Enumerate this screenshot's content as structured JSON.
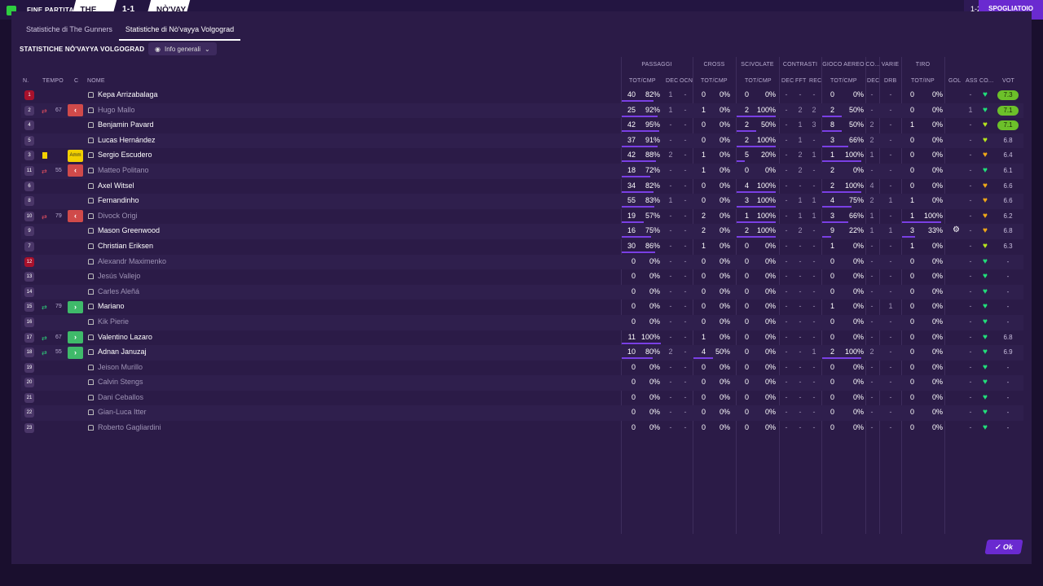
{
  "topbar": {
    "match_status": "FINE PARTITA",
    "home_abbr": "THE GU",
    "score": "1-1",
    "away_abbr": "NÒ'VAY",
    "score_right": "1-2",
    "dressing_room": "SPOGLIATOIO"
  },
  "tabs": [
    "Statistiche di The Gunners",
    "Statistiche di Nò'vayya Volgograd"
  ],
  "section_title": "STATISTICHE NÒ'VAYYA VOLGOGRAD",
  "filter_label": "Info generali",
  "groups": {
    "passaggi": "PASSAGGI",
    "cross": "CROSS",
    "scivolate": "SCIVOLATE",
    "contrasti": "CONTRASTI",
    "gioco_aereo": "GIOCO AEREO",
    "co": "CO...",
    "varie": "VARIE",
    "tiro": "TIRO"
  },
  "columns": {
    "n": "N.",
    "tempo": "TEMPO",
    "c": "C",
    "nome": "NOME",
    "pass_totcmp": "TOT/CMP",
    "pass_dec": "DEC",
    "pass_ocn": "OCN",
    "cross_totcmp": "TOT/CMP",
    "sciv_totcmp": "TOT/CMP",
    "con_dec": "DEC",
    "con_fft": "FFT",
    "con_rec": "REC",
    "aereo_totcmp": "TOT/CMP",
    "co_dec": "DEC",
    "varie_drb": "DRB",
    "tiro_totinp": "TOT/INP",
    "gol": "GOL",
    "ass": "ASS",
    "co2": "CO...",
    "voto": "VOT"
  },
  "players": [
    {
      "n": "1",
      "red": true,
      "sub": "",
      "mins": "",
      "c": "",
      "name": "Kepa Arrizabalaga",
      "dim": false,
      "p1": "40",
      "p2": "82%",
      "pb": 82,
      "pdec": "1",
      "pocn": "-",
      "c1": "0",
      "c2": "0%",
      "cb": 0,
      "s1": "0",
      "s2": "0%",
      "sb": 0,
      "cdec": "-",
      "cfft": "-",
      "crec": "-",
      "a1": "0",
      "a2": "0%",
      "ab": 0,
      "codec": "-",
      "drb": "-",
      "t1": "0",
      "t2": "0%",
      "tb": 0,
      "gol": "",
      "ass": "-",
      "heart": "green",
      "vote": "7.3",
      "hi": true
    },
    {
      "n": "2",
      "red": false,
      "sub": "out",
      "mins": "67",
      "c": "out",
      "name": "Hugo Mallo",
      "dim": true,
      "p1": "25",
      "p2": "92%",
      "pb": 92,
      "pdec": "1",
      "pocn": "-",
      "c1": "1",
      "c2": "0%",
      "cb": 0,
      "s1": "2",
      "s2": "100%",
      "sb": 100,
      "cdec": "-",
      "cfft": "2",
      "crec": "2",
      "a1": "2",
      "a2": "50%",
      "ab": 50,
      "codec": "-",
      "drb": "-",
      "t1": "0",
      "t2": "0%",
      "tb": 0,
      "gol": "",
      "ass": "1",
      "heart": "green",
      "vote": "7.1",
      "hi": true
    },
    {
      "n": "4",
      "red": false,
      "sub": "",
      "mins": "",
      "c": "",
      "name": "Benjamin Pavard",
      "dim": false,
      "p1": "42",
      "p2": "95%",
      "pb": 95,
      "pdec": "-",
      "pocn": "-",
      "c1": "0",
      "c2": "0%",
      "cb": 0,
      "s1": "2",
      "s2": "50%",
      "sb": 50,
      "cdec": "-",
      "cfft": "1",
      "crec": "3",
      "a1": "8",
      "a2": "50%",
      "ab": 50,
      "codec": "2",
      "drb": "-",
      "t1": "1",
      "t2": "0%",
      "tb": 0,
      "gol": "",
      "ass": "-",
      "heart": "lime",
      "vote": "7.1",
      "hi": true
    },
    {
      "n": "5",
      "red": false,
      "sub": "",
      "mins": "",
      "c": "",
      "name": "Lucas Hernández",
      "dim": false,
      "p1": "37",
      "p2": "91%",
      "pb": 91,
      "pdec": "-",
      "pocn": "-",
      "c1": "0",
      "c2": "0%",
      "cb": 0,
      "s1": "2",
      "s2": "100%",
      "sb": 100,
      "cdec": "-",
      "cfft": "1",
      "crec": "-",
      "a1": "3",
      "a2": "66%",
      "ab": 66,
      "codec": "2",
      "drb": "-",
      "t1": "0",
      "t2": "0%",
      "tb": 0,
      "gol": "",
      "ass": "-",
      "heart": "lime",
      "vote": "6.8",
      "hi": false
    },
    {
      "n": "3",
      "red": false,
      "sub": "yellow",
      "mins": "",
      "c": "amm",
      "name": "Sergio Escudero",
      "dim": false,
      "p1": "42",
      "p2": "88%",
      "pb": 88,
      "pdec": "2",
      "pocn": "-",
      "c1": "1",
      "c2": "0%",
      "cb": 0,
      "s1": "5",
      "s2": "20%",
      "sb": 20,
      "cdec": "-",
      "cfft": "2",
      "crec": "1",
      "a1": "1",
      "a2": "100%",
      "ab": 100,
      "codec": "1",
      "drb": "-",
      "t1": "0",
      "t2": "0%",
      "tb": 0,
      "gol": "",
      "ass": "-",
      "heart": "orange",
      "vote": "6.4",
      "hi": false
    },
    {
      "n": "11",
      "red": false,
      "sub": "out",
      "mins": "55",
      "c": "out",
      "name": "Matteo Politano",
      "dim": true,
      "p1": "18",
      "p2": "72%",
      "pb": 72,
      "pdec": "-",
      "pocn": "-",
      "c1": "1",
      "c2": "0%",
      "cb": 0,
      "s1": "0",
      "s2": "0%",
      "sb": 0,
      "cdec": "-",
      "cfft": "2",
      "crec": "-",
      "a1": "2",
      "a2": "0%",
      "ab": 0,
      "codec": "-",
      "drb": "-",
      "t1": "0",
      "t2": "0%",
      "tb": 0,
      "gol": "",
      "ass": "-",
      "heart": "green",
      "vote": "6.1",
      "hi": false
    },
    {
      "n": "6",
      "red": false,
      "sub": "",
      "mins": "",
      "c": "",
      "name": "Axel Witsel",
      "dim": false,
      "p1": "34",
      "p2": "82%",
      "pb": 82,
      "pdec": "-",
      "pocn": "-",
      "c1": "0",
      "c2": "0%",
      "cb": 0,
      "s1": "4",
      "s2": "100%",
      "sb": 100,
      "cdec": "-",
      "cfft": "-",
      "crec": "-",
      "a1": "2",
      "a2": "100%",
      "ab": 100,
      "codec": "4",
      "drb": "-",
      "t1": "0",
      "t2": "0%",
      "tb": 0,
      "gol": "",
      "ass": "-",
      "heart": "orange",
      "vote": "6.6",
      "hi": false
    },
    {
      "n": "8",
      "red": false,
      "sub": "",
      "mins": "",
      "c": "",
      "name": "Fernandinho",
      "dim": false,
      "p1": "55",
      "p2": "83%",
      "pb": 83,
      "pdec": "1",
      "pocn": "-",
      "c1": "0",
      "c2": "0%",
      "cb": 0,
      "s1": "3",
      "s2": "100%",
      "sb": 100,
      "cdec": "-",
      "cfft": "1",
      "crec": "1",
      "a1": "4",
      "a2": "75%",
      "ab": 75,
      "codec": "2",
      "drb": "1",
      "t1": "1",
      "t2": "0%",
      "tb": 0,
      "gol": "",
      "ass": "-",
      "heart": "orange",
      "vote": "6.6",
      "hi": false
    },
    {
      "n": "10",
      "red": false,
      "sub": "out",
      "mins": "79",
      "c": "out",
      "name": "Divock Origi",
      "dim": true,
      "p1": "19",
      "p2": "57%",
      "pb": 57,
      "pdec": "-",
      "pocn": "-",
      "c1": "2",
      "c2": "0%",
      "cb": 0,
      "s1": "1",
      "s2": "100%",
      "sb": 100,
      "cdec": "-",
      "cfft": "1",
      "crec": "1",
      "a1": "3",
      "a2": "66%",
      "ab": 66,
      "codec": "1",
      "drb": "-",
      "t1": "1",
      "t2": "100%",
      "tb": 100,
      "gol": "",
      "ass": "-",
      "heart": "orange",
      "vote": "6.2",
      "hi": false
    },
    {
      "n": "9",
      "red": false,
      "sub": "",
      "mins": "",
      "c": "",
      "name": "Mason Greenwood",
      "dim": false,
      "p1": "16",
      "p2": "75%",
      "pb": 75,
      "pdec": "-",
      "pocn": "-",
      "c1": "2",
      "c2": "0%",
      "cb": 0,
      "s1": "2",
      "s2": "100%",
      "sb": 100,
      "cdec": "-",
      "cfft": "2",
      "crec": "-",
      "a1": "9",
      "a2": "22%",
      "ab": 22,
      "codec": "1",
      "drb": "1",
      "t1": "3",
      "t2": "33%",
      "tb": 33,
      "gol": "gear",
      "ass": "-",
      "heart": "orange",
      "vote": "6.8",
      "hi": false
    },
    {
      "n": "7",
      "red": false,
      "sub": "",
      "mins": "",
      "c": "",
      "name": "Christian Eriksen",
      "dim": false,
      "p1": "30",
      "p2": "86%",
      "pb": 86,
      "pdec": "-",
      "pocn": "-",
      "c1": "1",
      "c2": "0%",
      "cb": 0,
      "s1": "0",
      "s2": "0%",
      "sb": 0,
      "cdec": "-",
      "cfft": "-",
      "crec": "-",
      "a1": "1",
      "a2": "0%",
      "ab": 0,
      "codec": "-",
      "drb": "-",
      "t1": "1",
      "t2": "0%",
      "tb": 0,
      "gol": "",
      "ass": "-",
      "heart": "lime",
      "vote": "6.3",
      "hi": false
    },
    {
      "n": "12",
      "red": true,
      "sub": "",
      "mins": "",
      "c": "",
      "name": "Alexandr Maximenko",
      "dim": true,
      "p1": "0",
      "p2": "0%",
      "pb": 0,
      "pdec": "-",
      "pocn": "-",
      "c1": "0",
      "c2": "0%",
      "cb": 0,
      "s1": "0",
      "s2": "0%",
      "sb": 0,
      "cdec": "-",
      "cfft": "-",
      "crec": "-",
      "a1": "0",
      "a2": "0%",
      "ab": 0,
      "codec": "-",
      "drb": "-",
      "t1": "0",
      "t2": "0%",
      "tb": 0,
      "gol": "",
      "ass": "-",
      "heart": "green",
      "vote": "-",
      "hi": false
    },
    {
      "n": "13",
      "red": false,
      "sub": "",
      "mins": "",
      "c": "",
      "name": "Jesús Vallejo",
      "dim": true,
      "p1": "0",
      "p2": "0%",
      "pb": 0,
      "pdec": "-",
      "pocn": "-",
      "c1": "0",
      "c2": "0%",
      "cb": 0,
      "s1": "0",
      "s2": "0%",
      "sb": 0,
      "cdec": "-",
      "cfft": "-",
      "crec": "-",
      "a1": "0",
      "a2": "0%",
      "ab": 0,
      "codec": "-",
      "drb": "-",
      "t1": "0",
      "t2": "0%",
      "tb": 0,
      "gol": "",
      "ass": "-",
      "heart": "green",
      "vote": "-",
      "hi": false
    },
    {
      "n": "14",
      "red": false,
      "sub": "",
      "mins": "",
      "c": "",
      "name": "Carles Aleñá",
      "dim": true,
      "p1": "0",
      "p2": "0%",
      "pb": 0,
      "pdec": "-",
      "pocn": "-",
      "c1": "0",
      "c2": "0%",
      "cb": 0,
      "s1": "0",
      "s2": "0%",
      "sb": 0,
      "cdec": "-",
      "cfft": "-",
      "crec": "-",
      "a1": "0",
      "a2": "0%",
      "ab": 0,
      "codec": "-",
      "drb": "-",
      "t1": "0",
      "t2": "0%",
      "tb": 0,
      "gol": "",
      "ass": "-",
      "heart": "green",
      "vote": "-",
      "hi": false
    },
    {
      "n": "15",
      "red": false,
      "sub": "in",
      "mins": "79",
      "c": "in",
      "name": "Mariano",
      "dim": false,
      "p1": "0",
      "p2": "0%",
      "pb": 0,
      "pdec": "-",
      "pocn": "-",
      "c1": "0",
      "c2": "0%",
      "cb": 0,
      "s1": "0",
      "s2": "0%",
      "sb": 0,
      "cdec": "-",
      "cfft": "-",
      "crec": "-",
      "a1": "1",
      "a2": "0%",
      "ab": 0,
      "codec": "-",
      "drb": "1",
      "t1": "0",
      "t2": "0%",
      "tb": 0,
      "gol": "",
      "ass": "-",
      "heart": "green",
      "vote": "-",
      "hi": false
    },
    {
      "n": "16",
      "red": false,
      "sub": "",
      "mins": "",
      "c": "",
      "name": "Kik Pierie",
      "dim": true,
      "p1": "0",
      "p2": "0%",
      "pb": 0,
      "pdec": "-",
      "pocn": "-",
      "c1": "0",
      "c2": "0%",
      "cb": 0,
      "s1": "0",
      "s2": "0%",
      "sb": 0,
      "cdec": "-",
      "cfft": "-",
      "crec": "-",
      "a1": "0",
      "a2": "0%",
      "ab": 0,
      "codec": "-",
      "drb": "-",
      "t1": "0",
      "t2": "0%",
      "tb": 0,
      "gol": "",
      "ass": "-",
      "heart": "green",
      "vote": "-",
      "hi": false
    },
    {
      "n": "17",
      "red": false,
      "sub": "in",
      "mins": "67",
      "c": "in",
      "name": "Valentino Lazaro",
      "dim": false,
      "p1": "11",
      "p2": "100%",
      "pb": 100,
      "pdec": "-",
      "pocn": "-",
      "c1": "1",
      "c2": "0%",
      "cb": 0,
      "s1": "0",
      "s2": "0%",
      "sb": 0,
      "cdec": "-",
      "cfft": "-",
      "crec": "-",
      "a1": "0",
      "a2": "0%",
      "ab": 0,
      "codec": "-",
      "drb": "-",
      "t1": "0",
      "t2": "0%",
      "tb": 0,
      "gol": "",
      "ass": "-",
      "heart": "green",
      "vote": "6.8",
      "hi": false
    },
    {
      "n": "18",
      "red": false,
      "sub": "in",
      "mins": "55",
      "c": "in",
      "name": "Adnan Januzaj",
      "dim": false,
      "p1": "10",
      "p2": "80%",
      "pb": 80,
      "pdec": "2",
      "pocn": "-",
      "c1": "4",
      "c2": "50%",
      "cb": 50,
      "s1": "0",
      "s2": "0%",
      "sb": 0,
      "cdec": "-",
      "cfft": "-",
      "crec": "1",
      "a1": "2",
      "a2": "100%",
      "ab": 100,
      "codec": "2",
      "drb": "-",
      "t1": "0",
      "t2": "0%",
      "tb": 0,
      "gol": "",
      "ass": "-",
      "heart": "green",
      "vote": "6.9",
      "hi": false
    },
    {
      "n": "19",
      "red": false,
      "sub": "",
      "mins": "",
      "c": "",
      "name": "Jeison Murillo",
      "dim": true,
      "p1": "0",
      "p2": "0%",
      "pb": 0,
      "pdec": "-",
      "pocn": "-",
      "c1": "0",
      "c2": "0%",
      "cb": 0,
      "s1": "0",
      "s2": "0%",
      "sb": 0,
      "cdec": "-",
      "cfft": "-",
      "crec": "-",
      "a1": "0",
      "a2": "0%",
      "ab": 0,
      "codec": "-",
      "drb": "-",
      "t1": "0",
      "t2": "0%",
      "tb": 0,
      "gol": "",
      "ass": "-",
      "heart": "green",
      "vote": "-",
      "hi": false
    },
    {
      "n": "20",
      "red": false,
      "sub": "",
      "mins": "",
      "c": "",
      "name": "Calvin Stengs",
      "dim": true,
      "p1": "0",
      "p2": "0%",
      "pb": 0,
      "pdec": "-",
      "pocn": "-",
      "c1": "0",
      "c2": "0%",
      "cb": 0,
      "s1": "0",
      "s2": "0%",
      "sb": 0,
      "cdec": "-",
      "cfft": "-",
      "crec": "-",
      "a1": "0",
      "a2": "0%",
      "ab": 0,
      "codec": "-",
      "drb": "-",
      "t1": "0",
      "t2": "0%",
      "tb": 0,
      "gol": "",
      "ass": "-",
      "heart": "green",
      "vote": "-",
      "hi": false
    },
    {
      "n": "21",
      "red": false,
      "sub": "",
      "mins": "",
      "c": "",
      "name": "Dani Ceballos",
      "dim": true,
      "p1": "0",
      "p2": "0%",
      "pb": 0,
      "pdec": "-",
      "pocn": "-",
      "c1": "0",
      "c2": "0%",
      "cb": 0,
      "s1": "0",
      "s2": "0%",
      "sb": 0,
      "cdec": "-",
      "cfft": "-",
      "crec": "-",
      "a1": "0",
      "a2": "0%",
      "ab": 0,
      "codec": "-",
      "drb": "-",
      "t1": "0",
      "t2": "0%",
      "tb": 0,
      "gol": "",
      "ass": "-",
      "heart": "green",
      "vote": "-",
      "hi": false
    },
    {
      "n": "22",
      "red": false,
      "sub": "",
      "mins": "",
      "c": "",
      "name": "Gian-Luca Itter",
      "dim": true,
      "p1": "0",
      "p2": "0%",
      "pb": 0,
      "pdec": "-",
      "pocn": "-",
      "c1": "0",
      "c2": "0%",
      "cb": 0,
      "s1": "0",
      "s2": "0%",
      "sb": 0,
      "cdec": "-",
      "cfft": "-",
      "crec": "-",
      "a1": "0",
      "a2": "0%",
      "ab": 0,
      "codec": "-",
      "drb": "-",
      "t1": "0",
      "t2": "0%",
      "tb": 0,
      "gol": "",
      "ass": "-",
      "heart": "green",
      "vote": "-",
      "hi": false
    },
    {
      "n": "23",
      "red": false,
      "sub": "",
      "mins": "",
      "c": "",
      "name": "Roberto Gagliardini",
      "dim": true,
      "p1": "0",
      "p2": "0%",
      "pb": 0,
      "pdec": "-",
      "pocn": "-",
      "c1": "0",
      "c2": "0%",
      "cb": 0,
      "s1": "0",
      "s2": "0%",
      "sb": 0,
      "cdec": "-",
      "cfft": "-",
      "crec": "-",
      "a1": "0",
      "a2": "0%",
      "ab": 0,
      "codec": "-",
      "drb": "-",
      "t1": "0",
      "t2": "0%",
      "tb": 0,
      "gol": "",
      "ass": "-",
      "heart": "green",
      "vote": "-",
      "hi": false
    }
  ],
  "amm_label": "Amm",
  "ok_label": "Ok",
  "colors": {
    "accent": "#6a2ad0",
    "bar": "#7a3fe4",
    "green": "#21e07a",
    "red": "#a8112c"
  }
}
